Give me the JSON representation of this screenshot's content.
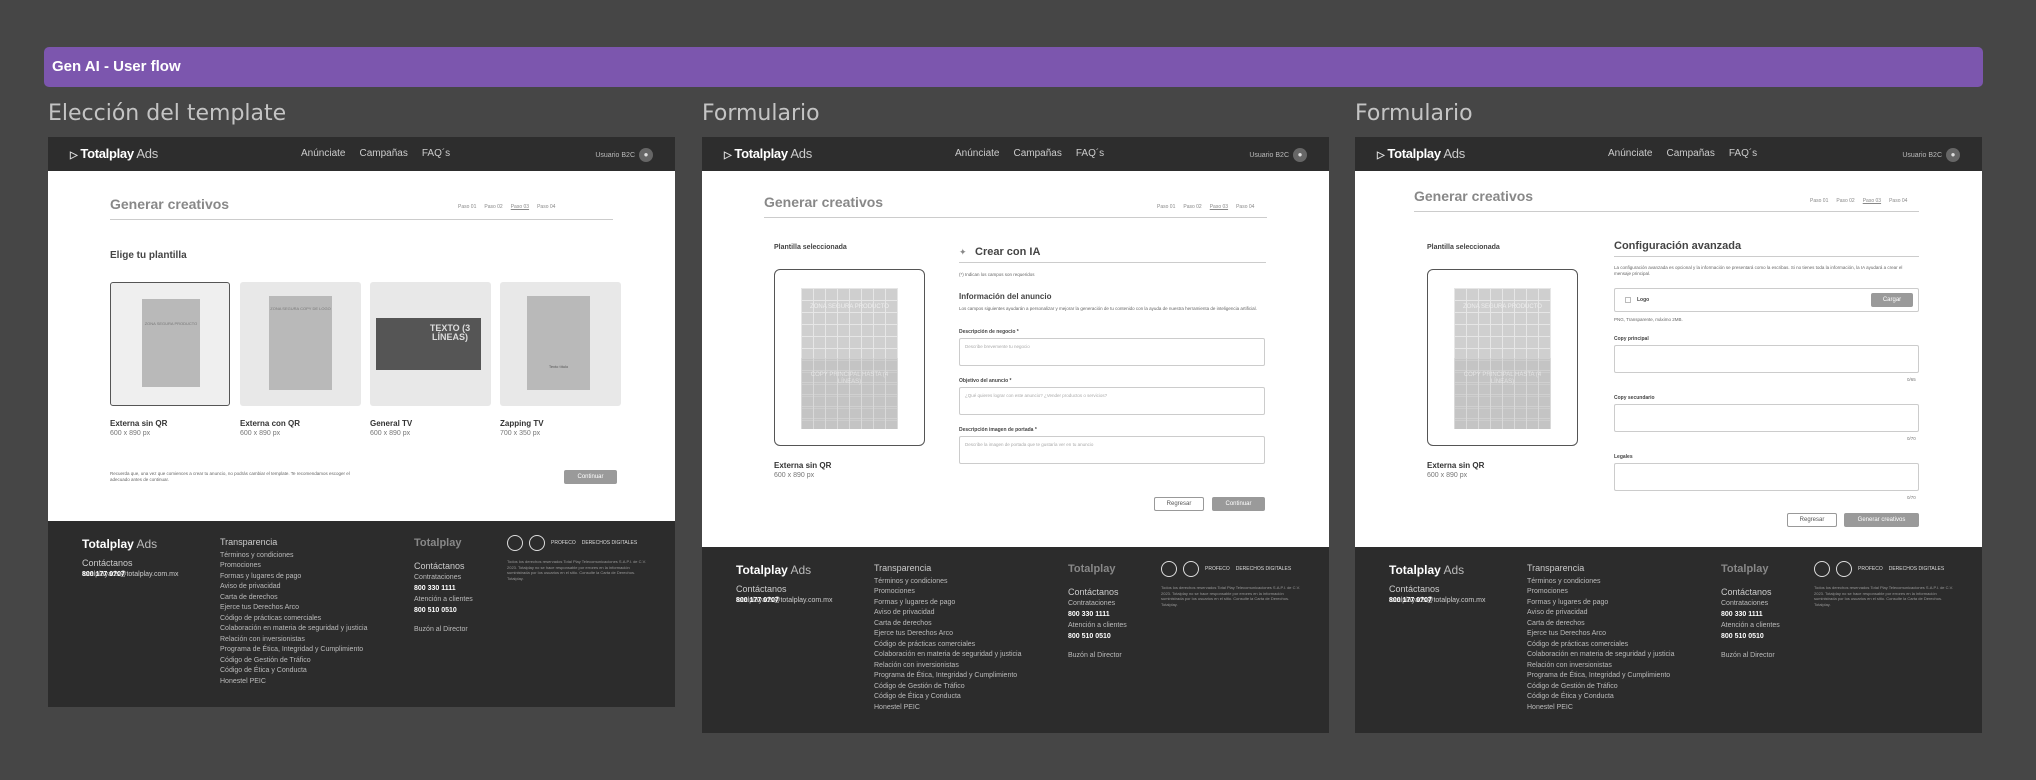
{
  "banner": "Gen AI - User flow",
  "frames": [
    {
      "title": "Elección del template"
    },
    {
      "title": "Formulario"
    },
    {
      "title": "Formulario"
    }
  ],
  "nav": {
    "logo_main": "Totalplay",
    "logo_ads": " Ads",
    "links": [
      "Anúnciate",
      "Campañas",
      "FAQ´s"
    ],
    "user": "Usuario B2C"
  },
  "page": {
    "title": "Generar creativos",
    "steps": [
      "Paso 01",
      "Paso 02",
      "Paso 03",
      "Paso 04"
    ]
  },
  "screen1": {
    "heading": "Elige tu plantilla",
    "cards": [
      {
        "name": "Externa sin QR",
        "size": "600 x 890 px",
        "inner": "ZONA SEGURA PRODUCTO"
      },
      {
        "name": "Externa con QR",
        "size": "600 x 890 px",
        "inner": "ZONA SEGURA COPY DE LOGO"
      },
      {
        "name": "General TV",
        "size": "600 x 890 px",
        "inner": "TEXTO (3 LÍNEAS)"
      },
      {
        "name": "Zapping TV",
        "size": "700 x 350 px",
        "inner": "Texto título"
      }
    ],
    "note": "Recuerda que, una vez que comiences a crear tu anuncio, no podrás cambiar el template. Te recomendamos escoger el adecuado antes de continuar.",
    "continue": "Continuar"
  },
  "screen2": {
    "selected_label": "Plantilla seleccionada",
    "tpl_top": "ZONA SEGURA PRODUCTO",
    "tpl_bottom": "COPY PRINCIPAL HASTA (4 LÍNEAS)",
    "tpl_name": "Externa sin QR",
    "tpl_size": "600 x 890 px",
    "ai_title": "Crear con IA",
    "required": "(*) Indican los campos son requeridos",
    "info_title": "Información del anuncio",
    "info_desc": "Los campos siguientes ayudarán a personalizar y mejorar la generación de tu contenido con la ayuda de nuestra herramienta de inteligencia artificial.",
    "fields": [
      {
        "label": "Descripción de negocio *",
        "placeholder": "Describe brevemente tu negocio"
      },
      {
        "label": "Objetivo del anuncio *",
        "placeholder": "¿Qué quieres lograr con este anuncio? ¿Vender productos o servicios?"
      },
      {
        "label": "Descripción imagen de portada *",
        "placeholder": "Describe la imagen de portada que te gustaría ver en tu anuncio"
      }
    ],
    "back": "Regresar",
    "continue": "Continuar"
  },
  "screen3": {
    "selected_label": "Plantilla seleccionada",
    "tpl_top": "ZONA SEGURA PRODUCTO",
    "tpl_bottom": "COPY PRINCIPAL HASTA (4 LÍNEAS)",
    "tpl_name": "Externa sin QR",
    "tpl_size": "600 x 890 px",
    "adv_title": "Configuración avanzada",
    "adv_desc": "La configuración avanzada es opcional y la información se presentará como la escribas. Si no tienes toda la información, la IA ayudará a crear el mensaje principal.",
    "logo_label": "Logo",
    "upload": "Cargar",
    "logo_hint": "PNG, Transparente, máximo 2MB.",
    "fields": [
      {
        "label": "Copy principal",
        "count": "0/65"
      },
      {
        "label": "Copy secundario",
        "count": "0/70"
      },
      {
        "label": "Legales",
        "count": "0/70"
      }
    ],
    "back": "Regresar",
    "generate": "Generar creativos"
  },
  "footer": {
    "logo_main": "Totalplay",
    "logo_ads": " Ads",
    "contact_title": "Contáctanos",
    "phone": "800 177 0707",
    "email": "totalplayads@totalplay.com.mx",
    "trans_title": "Transparencia",
    "links": [
      "Términos y condiciones",
      "Promociones",
      "Formas y lugares de pago",
      "Aviso de privacidad",
      "Carta de derechos",
      "Ejerce tus Derechos Arco",
      "Código de prácticas comerciales",
      "Colaboración en materia de seguridad y justicia",
      "Relación con inversionistas",
      "Programa de Ética, Integridad y Cumplimiento",
      "Código de Gestión de Tráfico",
      "Código de Ética y Conducta",
      "Honestel PEIC"
    ],
    "tp_logo": "Totalplay",
    "col3_title": "Contáctanos",
    "sales_label": "Contrataciones",
    "sales_phone": "800 330 1111",
    "support_label": "Atención a clientes",
    "support_phone": "800 510 0510",
    "director": "Buzón al Director",
    "badges": [
      "PROFECO",
      "DERECHOS DIGITALES"
    ],
    "legal": "Todos los derechos reservados Total Play Telecomunicaciones S.A.P.I. de C.V. 2023. Totalplay no se hace responsable por errores en la información suministrada por los usuarios en el sitio. Consulte la Carta de Derechos. Totalplay."
  }
}
